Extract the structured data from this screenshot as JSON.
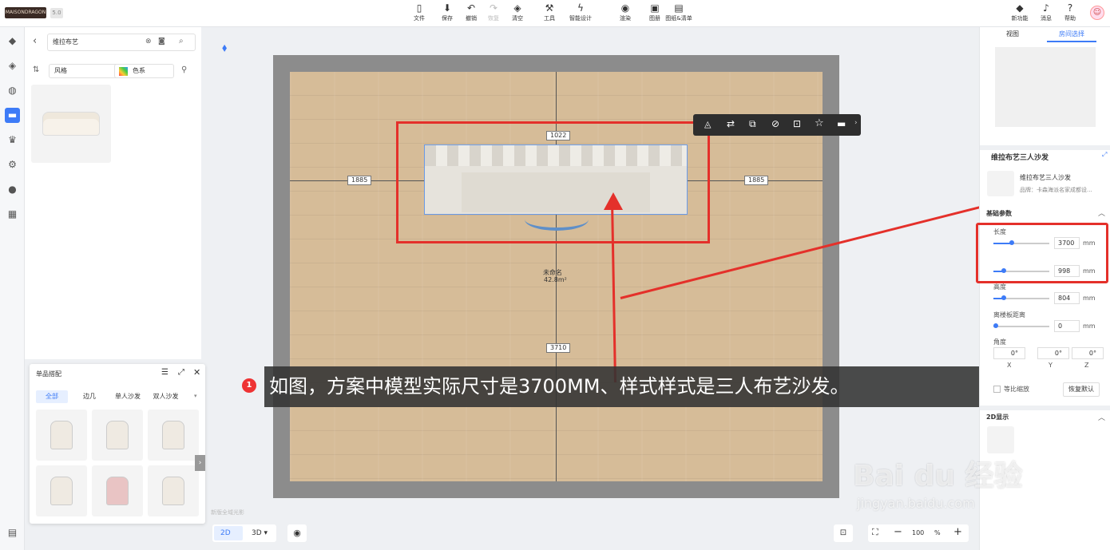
{
  "topbar": {
    "logo": "MAISONDRAGON",
    "version": "5.0",
    "tools": [
      {
        "icon": "file-icon",
        "label": "文件",
        "glyph": "▯"
      },
      {
        "icon": "save-icon",
        "label": "保存",
        "glyph": "⬇"
      },
      {
        "icon": "undo-icon",
        "label": "撤销",
        "glyph": "↶"
      },
      {
        "icon": "redo-icon",
        "label": "恢复",
        "glyph": "↷"
      },
      {
        "icon": "eraser-icon",
        "label": "清空",
        "glyph": "◈"
      },
      {
        "icon": "wrench-icon",
        "label": "工具",
        "glyph": "⚒"
      },
      {
        "icon": "lightning-icon",
        "label": "智能设计",
        "glyph": "ϟ"
      },
      {
        "icon": "render-icon",
        "label": "渲染",
        "glyph": "◉"
      },
      {
        "icon": "album-icon",
        "label": "图册",
        "glyph": "▣"
      },
      {
        "icon": "drawing-icon",
        "label": "图纸&清单",
        "glyph": "▤"
      }
    ],
    "right_tools": [
      {
        "icon": "new-feature-icon",
        "label": "新功能",
        "glyph": "◆"
      },
      {
        "icon": "bell-icon",
        "label": "消息",
        "glyph": "♪"
      },
      {
        "icon": "help-icon",
        "label": "帮助",
        "glyph": "?"
      }
    ]
  },
  "leftbar": {
    "icons": [
      "cube-icon",
      "layers-icon",
      "bulb-icon",
      "sofa-icon",
      "crown-icon",
      "model-icon",
      "person-icon",
      "calendar-icon"
    ],
    "bottom_icon": "list-icon"
  },
  "panel": {
    "search_value": "维拉布艺",
    "filter_style": "风格",
    "filter_color": "色系"
  },
  "canvas": {
    "dim_top": "1022",
    "dim_left": "1885",
    "dim_right": "1885",
    "dim_bottom": "3710",
    "room_name": "未命名",
    "room_area": "42.8m²",
    "watermark_hint": "新版全域光影",
    "view_2d": "2D",
    "view_3d": "3D",
    "zoom": "100",
    "zoom_unit": "%"
  },
  "subtitle": {
    "badge": "1",
    "text": "如图，方案中模型实际尺寸是3700MM、样式样式是三人布艺沙发。"
  },
  "combo": {
    "title": "单品搭配",
    "tabs": [
      "全部",
      "边几",
      "单人沙发",
      "双人沙发"
    ]
  },
  "right": {
    "tab_view": "视图",
    "tab_room": "房间选择",
    "product_title": "维拉布艺三人沙发",
    "product_name": "维拉布艺三人沙发",
    "brand": "品牌：卡森海派名家成都设...",
    "section_basic": "基础参数",
    "len_label": "长度",
    "len_val": "3700",
    "wid_val": "998",
    "hei_label": "高度",
    "hei_val": "804",
    "floor_label": "离楼板距离",
    "floor_val": "0",
    "unit": "mm",
    "angle_label": "角度",
    "angle_x": "0",
    "angle_y": "0",
    "angle_z": "0",
    "ax": "X",
    "ay": "Y",
    "az": "Z",
    "lock_ratio": "等比缩放",
    "reset": "恢复默认",
    "section_2d": "2D显示"
  },
  "watermark": {
    "brand": "Bai du 经验",
    "url": "jingyan.baidu.com"
  }
}
